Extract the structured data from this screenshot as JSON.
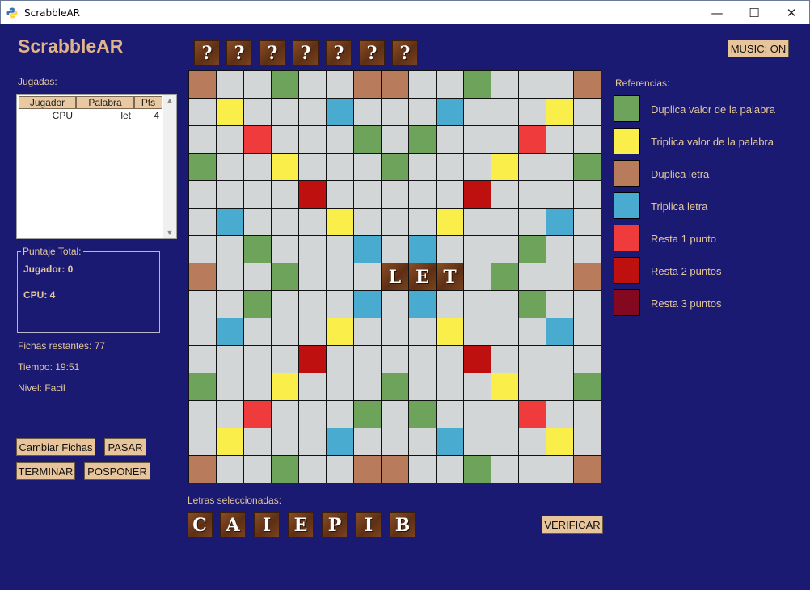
{
  "window": {
    "title": "ScrabbleAR",
    "minimize": "—",
    "maximize": "☐",
    "close": "✕"
  },
  "app_title": "ScrabbleAR",
  "plays": {
    "label": "Jugadas:",
    "columns": [
      "Jugador",
      "Palabra",
      "Pts"
    ],
    "rows": [
      {
        "player": "CPU",
        "word": "let",
        "points": "4"
      }
    ],
    "scroll_up": "▲",
    "scroll_down": "▼"
  },
  "score": {
    "legend": "Puntaje Total:",
    "player": "Jugador: 0",
    "cpu": "CPU: 4"
  },
  "info": {
    "remaining": "Fichas restantes: 77",
    "time": "Tiempo: 19:51",
    "level": "Nivel: Facil"
  },
  "buttons": {
    "change": "Cambiar Fichas",
    "pass": "PASAR",
    "finish": "TERMINAR",
    "postpone": "POSPONER",
    "music": "MUSIC: ON",
    "verify": "VERIFICAR"
  },
  "cpu_rack": [
    "?",
    "?",
    "?",
    "?",
    "?",
    "?",
    "?"
  ],
  "player_rack": {
    "label": "Letras seleccionadas:",
    "letters": [
      "C",
      "A",
      "I",
      "E",
      "P",
      "I",
      "B"
    ]
  },
  "board": {
    "rows": [
      "L..P..LL..P...L",
      ".3...T...T...3.",
      "..1...P.P...1..",
      "P..3...P...3..P",
      "....2.....2....",
      ".T...3...3...T.",
      "..P...T.T...P..",
      "L..P...LET.P..L",
      "..P...T.T...P..",
      ".T...3...3...T.",
      "....2.....2....",
      "P..3...P...3..P",
      "..1...P.P...1..",
      ".3...T...T...3.",
      "L..P..LL..P...L"
    ]
  },
  "legend": {
    "title": "Referencias:",
    "items": [
      {
        "color": "#6ea35c",
        "label": "Duplica valor de la palabra"
      },
      {
        "color": "#f9ee4a",
        "label": "Triplica valor de la palabra"
      },
      {
        "color": "#b87c5c",
        "label": "Duplica letra"
      },
      {
        "color": "#4aabd1",
        "label": "Triplica letra"
      },
      {
        "color": "#ef3b3b",
        "label": "Resta 1 punto"
      },
      {
        "color": "#bf1010",
        "label": "Resta 2 puntos"
      },
      {
        "color": "#84081f",
        "label": "Resta 3 puntos"
      }
    ]
  }
}
